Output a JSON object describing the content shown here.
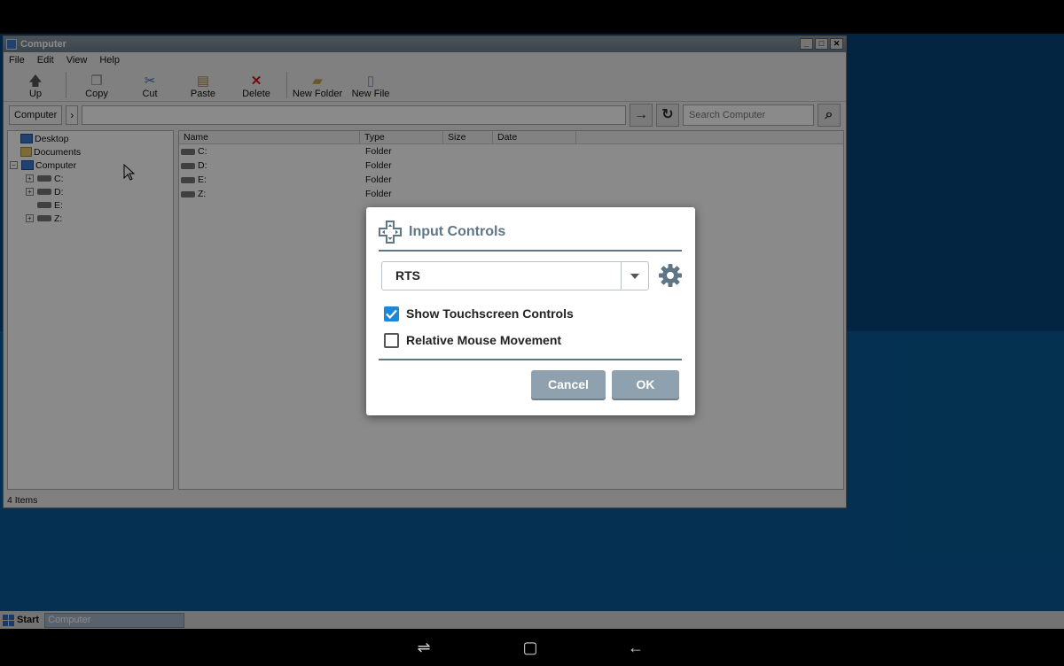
{
  "window": {
    "title": "Computer",
    "menu": [
      "File",
      "Edit",
      "View",
      "Help"
    ],
    "toolbar": [
      {
        "label": "Up",
        "icon": "arrow-up-icon"
      },
      {
        "label": "Copy",
        "icon": "copy-icon"
      },
      {
        "label": "Cut",
        "icon": "scissors-icon"
      },
      {
        "label": "Paste",
        "icon": "paste-icon"
      },
      {
        "label": "Delete",
        "icon": "delete-icon"
      },
      {
        "label": "New Folder",
        "icon": "new-folder-icon"
      },
      {
        "label": "New File",
        "icon": "new-file-icon"
      }
    ],
    "address": {
      "crumb": "Computer",
      "search_placeholder": "Search Computer"
    },
    "tree": [
      {
        "label": "Desktop"
      },
      {
        "label": "Documents"
      },
      {
        "label": "Computer"
      },
      {
        "label": "C:"
      },
      {
        "label": "D:"
      },
      {
        "label": "E:"
      },
      {
        "label": "Z:"
      }
    ],
    "columns": [
      "Name",
      "Type",
      "Size",
      "Date"
    ],
    "rows": [
      {
        "name": "C:",
        "type": "Folder"
      },
      {
        "name": "D:",
        "type": "Folder"
      },
      {
        "name": "E:",
        "type": "Folder"
      },
      {
        "name": "Z:",
        "type": "Folder"
      }
    ],
    "status": "4 Items"
  },
  "taskbar": {
    "start": "Start",
    "task": "Computer"
  },
  "dialog": {
    "title": "Input Controls",
    "profile": "RTS",
    "options": [
      {
        "label": "Show Touchscreen Controls",
        "checked": true
      },
      {
        "label": "Relative Mouse Movement",
        "checked": false
      }
    ],
    "cancel": "Cancel",
    "ok": "OK"
  },
  "colors": {
    "desktop": "#06457a",
    "dialog_accent": "#5f7686",
    "checkbox": "#1e88d6",
    "button": "#8fa1ae"
  }
}
